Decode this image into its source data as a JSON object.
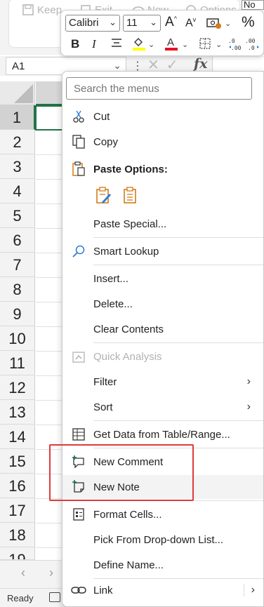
{
  "ribbon": {
    "items": [
      {
        "label": "Keep",
        "icon": "save-icon"
      },
      {
        "label": "Exit",
        "icon": "exit-icon"
      },
      {
        "label": "New",
        "icon": "new-view-icon"
      },
      {
        "label": "Options",
        "icon": "options-icon"
      }
    ],
    "top_cell_text": "No"
  },
  "formula_bar": {
    "name_box": "A1",
    "fx_label": "fx"
  },
  "sheet": {
    "rows": [
      "1",
      "2",
      "3",
      "4",
      "5",
      "6",
      "7",
      "8",
      "9",
      "10",
      "11",
      "12",
      "13",
      "14",
      "15",
      "16",
      "17",
      "18",
      "19"
    ],
    "selected_cell": "A1"
  },
  "mini_toolbar": {
    "font_name": "Calibri",
    "font_size": "11",
    "bold": "B",
    "italic": "I",
    "percent": "%",
    "colors": {
      "highlight": "#ffff00",
      "font_color": "#e81123"
    }
  },
  "context_menu": {
    "search_placeholder": "Search the menus",
    "items": {
      "cut": "Cut",
      "copy": "Copy",
      "paste_options": "Paste Options:",
      "paste_special": "Paste Special...",
      "smart_lookup": "Smart Lookup",
      "insert": "Insert...",
      "delete": "Delete...",
      "clear_contents": "Clear Contents",
      "quick_analysis": "Quick Analysis",
      "filter": "Filter",
      "sort": "Sort",
      "get_data": "Get Data from Table/Range...",
      "new_comment": "New Comment",
      "new_note": "New Note",
      "format_cells": "Format Cells...",
      "pick_from_list": "Pick From Drop-down List...",
      "define_name": "Define Name...",
      "link": "Link"
    }
  },
  "status_bar": {
    "status": "Ready"
  },
  "accent_colors": {
    "excel_green": "#217346",
    "highlight_red": "#e03a3a",
    "icon_blue": "#2b7cd3",
    "icon_orange": "#d47b1a"
  }
}
